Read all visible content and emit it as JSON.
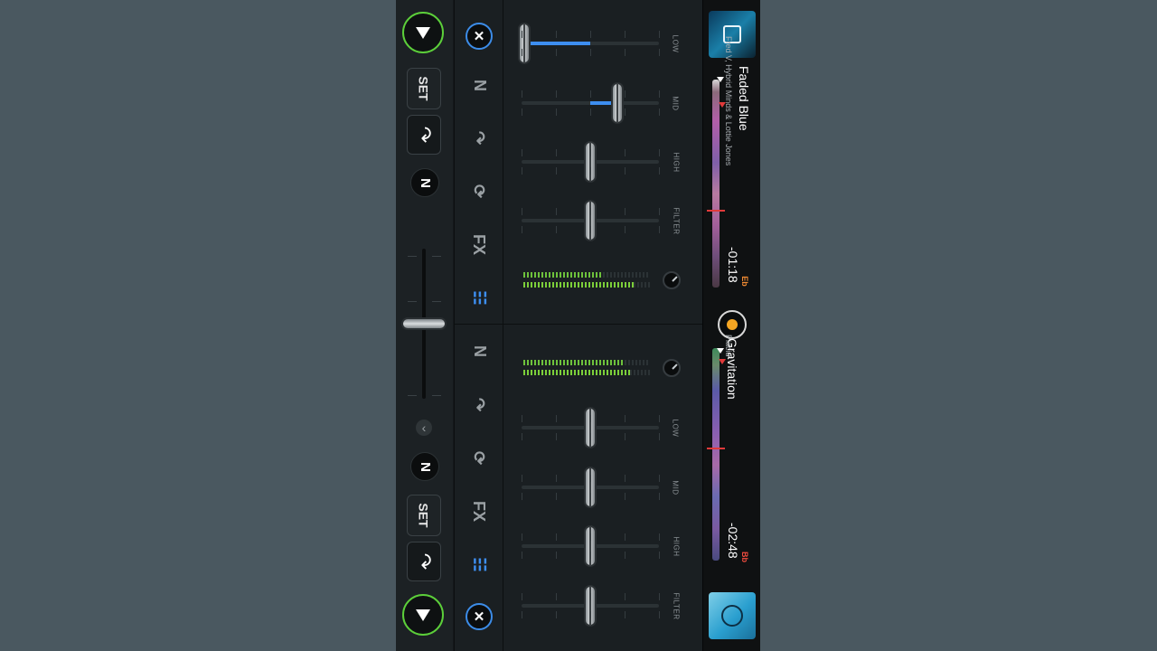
{
  "deck_a": {
    "artist": "Fred V, Hybrid Minds & Lottie Jones",
    "title": "Faded Blue",
    "time": "-01:18",
    "key": "Eb",
    "key_color": "#f08a33"
  },
  "deck_b": {
    "artist": "Placid",
    "title": "Gravitation",
    "time": "-02:48",
    "key": "Bb",
    "key_color": "#ee4b3e"
  },
  "controls": {
    "set_top": "SET",
    "set_bottom": "SET",
    "fx_label": "FX",
    "collapse_arrow": "‹"
  },
  "mixer_top": {
    "bands": [
      "LOW",
      "MID",
      "HIGH",
      "FILTER"
    ],
    "levels": [
      0.0,
      0.7,
      0.5,
      0.5
    ]
  },
  "mixer_bottom": {
    "bands": [
      "LOW",
      "MID",
      "HIGH",
      "FILTER"
    ],
    "levels": [
      0.5,
      0.5,
      0.5,
      0.5
    ]
  },
  "crossfader": {
    "level": 0.5
  },
  "colors": {
    "accent_green": "#5ccf3a",
    "accent_blue": "#3d8ef0",
    "record_dot": "#f5a623"
  }
}
